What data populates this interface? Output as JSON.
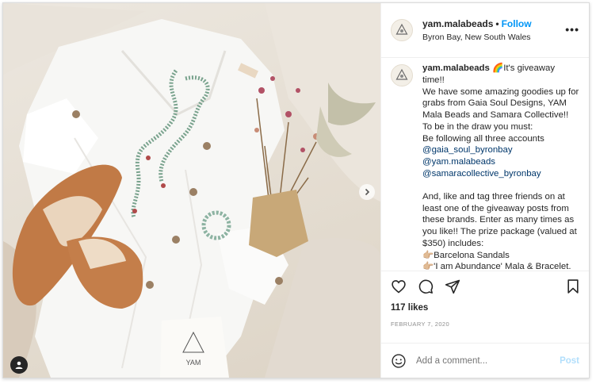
{
  "post": {
    "username": "yam.malabeads",
    "follow_label": "Follow",
    "location": "Byron Bay, New South Wales",
    "caption_username": "yam.malabeads",
    "caption_lines": [
      "🌈It's giveaway time!!",
      "We have some amazing goodies up for grabs from Gaia Soul Designs, YAM Mala Beads and Samara Collective!! To be in the draw you must:",
      "Be following all three accounts"
    ],
    "mentions": [
      "@gaia_soul_byronbay",
      "@yam.malabeads",
      "@samaracollective_byronbay"
    ],
    "caption_lines_2": [
      "And, like and tag three friends on at least one of the giveaway posts from these brands. Enter as many times as you like!! The prize package (valued at $350) includes:",
      "👉🏼Barcelona Sandals",
      "👉🏼'I am Abundance' Mala & Bracelet."
    ],
    "likes": "117 likes",
    "date": "FEBRUARY 7, 2020",
    "comment_placeholder": "Add a comment...",
    "post_label": "Post",
    "bag_logo_text": "YAM"
  },
  "colors": {
    "link_blue": "#0095f6",
    "mention_blue": "#00376b",
    "post_disabled": "#b2dffc",
    "muted": "#8e8e8e"
  },
  "icons": [
    "avatar-logo-icon",
    "more-options-icon",
    "heart-icon",
    "comment-icon",
    "share-icon",
    "bookmark-icon",
    "emoji-icon",
    "next-arrow-icon",
    "user-tag-icon"
  ]
}
